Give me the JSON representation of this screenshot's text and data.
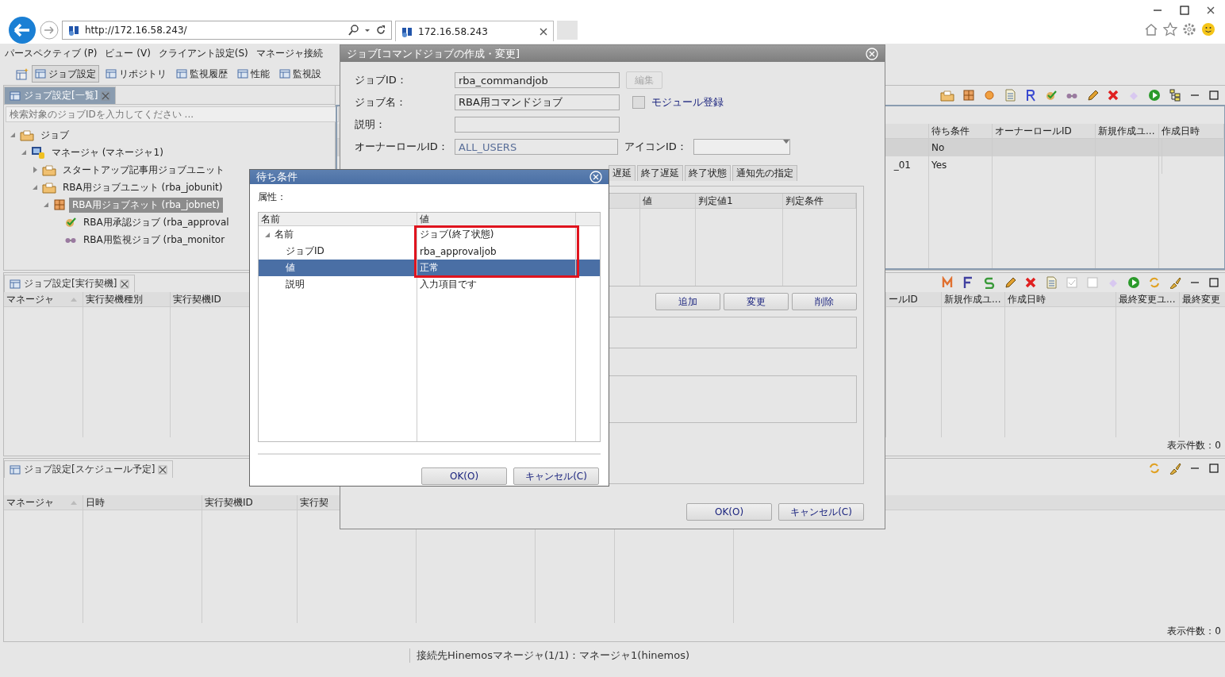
{
  "browser": {
    "address": "http://172.16.58.243/",
    "tab_title": "172.16.58.243"
  },
  "menu": [
    "パースペクティブ (P)",
    "ビュー (V)",
    "クライアント設定(S)",
    "マネージャ接続"
  ],
  "perspectives": [
    {
      "label": "ジョブ設定",
      "selected": true
    },
    {
      "label": "リポジトリ",
      "selected": false
    },
    {
      "label": "監視履歴",
      "selected": false
    },
    {
      "label": "性能",
      "selected": false
    },
    {
      "label": "監視設",
      "selected": false
    }
  ],
  "job_list": {
    "tab": "ジョブ設定[一覧]",
    "search": {
      "placeholder": "検索対象のジョブIDを入力してください ..."
    },
    "tree": [
      {
        "label": "ジョブ",
        "kind": "folder",
        "expanded": true,
        "selected": false,
        "children": [
          {
            "label": "マネージャ (マネージャ1)",
            "kind": "manager",
            "expanded": true,
            "selected": false,
            "children": [
              {
                "label": "スタートアップ記事用ジョブユニット",
                "kind": "folder",
                "expanded": false,
                "selected": false
              },
              {
                "label": "RBA用ジョブユニット (rba_jobunit)",
                "kind": "folder",
                "expanded": true,
                "selected": false,
                "children": [
                  {
                    "label": "RBA用ジョブネット (rba_jobnet)",
                    "kind": "jobnet",
                    "expanded": true,
                    "selected": true,
                    "children": [
                      {
                        "label": "RBA用承認ジョブ (rba_approval",
                        "kind": "approval",
                        "selected": false
                      },
                      {
                        "label": "RBA用監視ジョブ (rba_monitor",
                        "kind": "monitor",
                        "selected": false
                      }
                    ]
                  }
                ]
              }
            ]
          }
        ]
      }
    ]
  },
  "job_table": {
    "columns": [
      "待ち条件",
      "オーナーロールID",
      "新規作成ユ...",
      "作成日時"
    ],
    "rows": [
      {
        "selected": true,
        "cells": [
          "No"
        ]
      },
      {
        "selected": false,
        "column_1": "_01",
        "cells": [
          "Yes"
        ]
      }
    ]
  },
  "trigger_view": {
    "tab": "ジョブ設定[実行契機]",
    "columns_left": [
      "マネージャ",
      "実行契機種別",
      "実行契機ID"
    ],
    "columns_right": [
      "ールID",
      "新規作成ユ...",
      "作成日時",
      "最終変更ユ...",
      "最終変更"
    ],
    "count": "表示件数：0"
  },
  "schedule_view": {
    "tab": "ジョブ設定[スケジュール予定]",
    "columns": [
      "マネージャ",
      "日時",
      "実行契機ID",
      "実行契"
    ],
    "count": "表示件数：0"
  },
  "status_bar": "接続先Hinemosマネージャ(1/1)：マネージャ1(hinemos)",
  "job_dialog": {
    "title": "ジョブ[コマンドジョブの作成・変更]",
    "fields": [
      {
        "label": "ジョブID：",
        "value": "rba_commandjob"
      },
      {
        "label": "ジョブ名：",
        "value": "RBA用コマンドジョブ"
      },
      {
        "label": "説明："
      },
      {
        "label": "オーナーロールID：",
        "value": "ALL_USERS"
      }
    ],
    "edit_button": {
      "label": "編集",
      "disabled": true
    },
    "module_checkbox": {
      "label": "モジュール登録",
      "checked": false
    },
    "icon_id_label": "アイコンID：",
    "tabs": [
      {
        "label": "遅延",
        "selected": false
      },
      {
        "label": "終了遅延",
        "selected": false
      },
      {
        "label": "終了状態",
        "selected": false
      },
      {
        "label": "通知先の指定",
        "selected": false
      }
    ],
    "table_columns": [
      "値",
      "判定値1",
      "判定条件"
    ],
    "row_buttons": [
      "追加",
      "変更",
      "削除"
    ],
    "buttons": [
      "OK(O)",
      "キャンセル(C)"
    ]
  },
  "wait_dialog": {
    "title": "待ち条件",
    "attributes_label": "属性：",
    "columns": [
      "名前",
      "値"
    ],
    "rows": [
      {
        "name": "名前",
        "value": "ジョブ(終了状態)",
        "expanded": true,
        "selected": false,
        "children": [
          {
            "name": "ジョブID",
            "value": "rba_approvaljob",
            "selected": false
          },
          {
            "name": "値",
            "value": "正常",
            "selected": true
          },
          {
            "name": "説明",
            "value": "入力項目です",
            "selected": false
          }
        ]
      }
    ],
    "buttons": [
      "OK(O)",
      "キャンセル(C)"
    ]
  }
}
